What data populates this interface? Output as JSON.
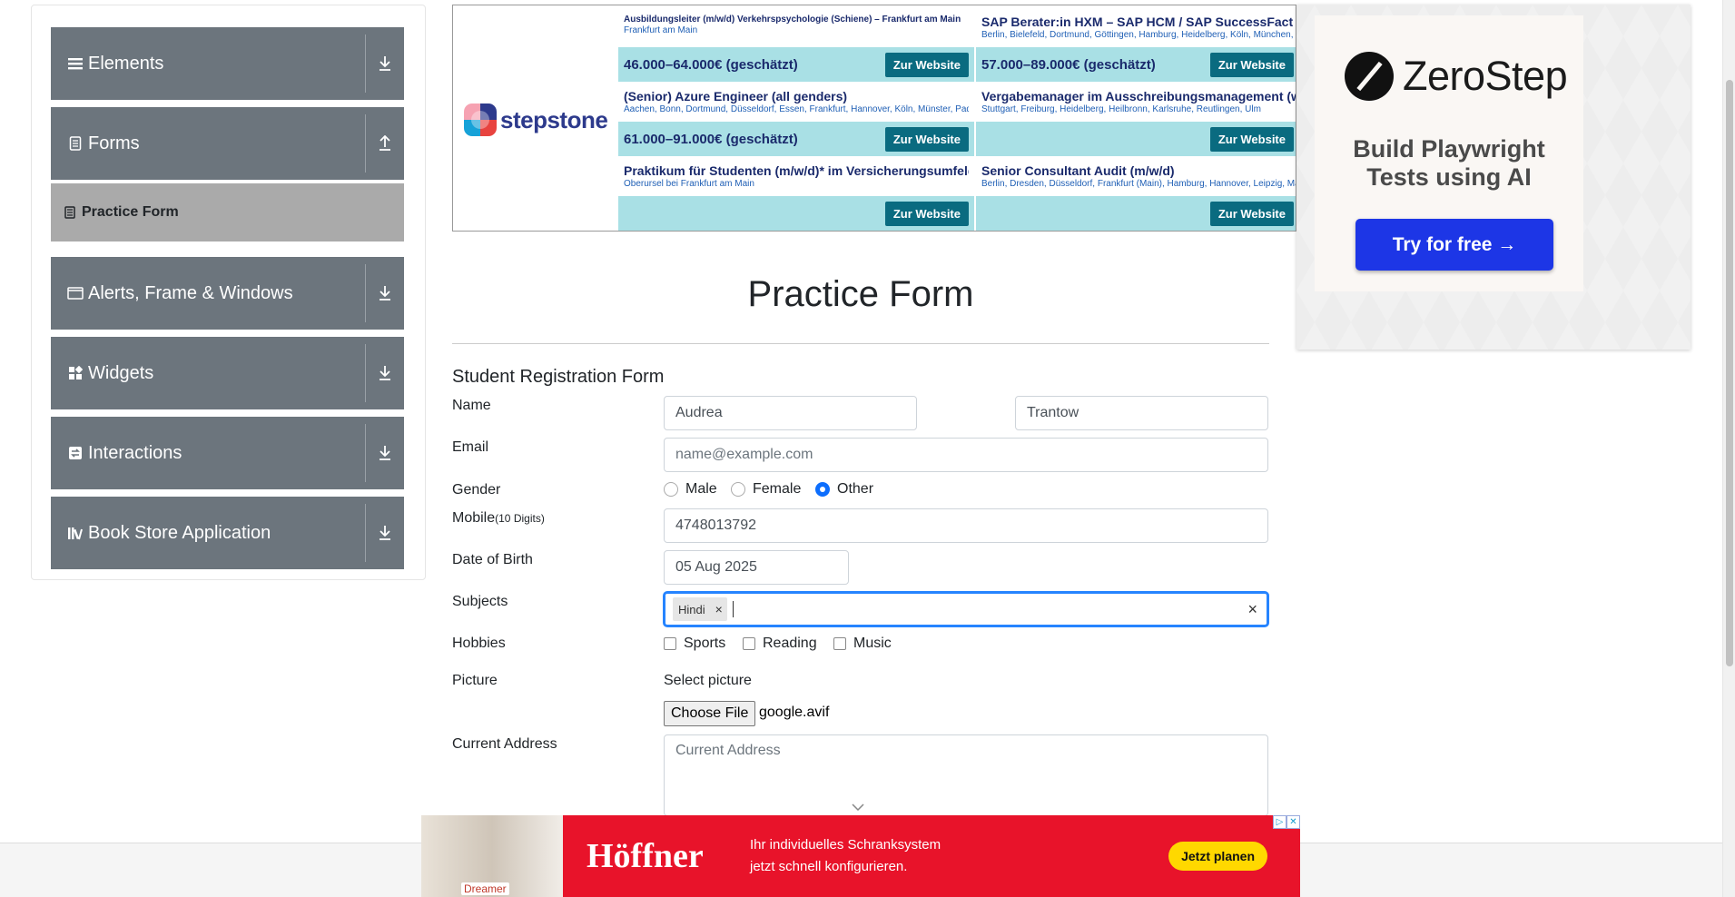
{
  "sidebar": {
    "groups": [
      {
        "label": "Elements",
        "icon": "hamburger-icon",
        "arrow": "download-icon"
      },
      {
        "label": "Forms",
        "icon": "document-icon",
        "arrow": "upload-icon"
      },
      {
        "label": "Alerts, Frame & Windows",
        "icon": "window-icon",
        "arrow": "download-icon"
      },
      {
        "label": "Widgets",
        "icon": "widgets-icon",
        "arrow": "download-icon"
      },
      {
        "label": "Interactions",
        "icon": "interactions-icon",
        "arrow": "download-icon"
      },
      {
        "label": "Book Store Application",
        "icon": "books-icon",
        "arrow": "download-icon"
      }
    ],
    "active_item": "Practice Form"
  },
  "stepstone_ad": {
    "brand": "stepstone",
    "jobs": [
      {
        "title": "Ausbildungsleiter (m/w/d) Verkehrspsychologie (Schiene) – Frankfurt am Main",
        "location": "Frankfurt am Main",
        "salary": "46.000–64.000€ (geschätzt)",
        "button": "Zur Website"
      },
      {
        "title": "SAP Berater:in HXM – SAP HCM / SAP SuccessFact",
        "location": "Berlin, Bielefeld, Dortmund, Göttingen, Hamburg, Heidelberg, Köln, München, Pforzheim",
        "salary": "57.000–89.000€ (geschätzt)",
        "button": "Zur Website"
      },
      {
        "title": "(Senior) Azure Engineer (all genders)",
        "location": "Aachen, Bonn, Dortmund, Düsseldorf, Essen, Frankfurt, Hannover, Köln, Münster, Paderborn...",
        "salary": "61.000–91.000€ (geschätzt)",
        "button": "Zur Website"
      },
      {
        "title": "Vergabemanager im Ausschreibungsmanagement (w/m",
        "location": "Stuttgart, Freiburg, Heidelberg, Heilbronn, Karlsruhe, Reutlingen, Ulm",
        "salary": "",
        "button": "Zur Website"
      },
      {
        "title": "Praktikum für Studenten (m/w/d)* im Versicherungsumfeld",
        "location": "Oberursel bei Frankfurt am Main",
        "salary": "",
        "button": "Zur Website"
      },
      {
        "title": "Senior Consultant Audit (m/w/d)",
        "location": "Berlin, Dresden, Düsseldorf, Frankfurt (Main), Hamburg, Hannover, Leipzig, Magdeburg",
        "salary": "",
        "button": "Zur Website"
      }
    ]
  },
  "zerostep_ad": {
    "brand": "ZeroStep",
    "tagline": "Build Playwright Tests using AI",
    "button": "Try for free →"
  },
  "form": {
    "page_title": "Practice Form",
    "form_title": "Student Registration Form",
    "labels": {
      "name": "Name",
      "email": "Email",
      "gender": "Gender",
      "mobile": "Mobile",
      "mobile_hint": "(10 Digits)",
      "dob": "Date of Birth",
      "subjects": "Subjects",
      "hobbies": "Hobbies",
      "picture": "Picture",
      "address": "Current Address"
    },
    "first_name": "Audrea",
    "last_name": "Trantow",
    "email_placeholder": "name@example.com",
    "genders": [
      {
        "label": "Male",
        "checked": false
      },
      {
        "label": "Female",
        "checked": false
      },
      {
        "label": "Other",
        "checked": true
      }
    ],
    "mobile": "4748013792",
    "dob": "05 Aug 2025",
    "subjects": [
      "Hindi"
    ],
    "subject_remove": "×",
    "subjects_clear": "×",
    "hobbies": [
      {
        "label": "Sports",
        "checked": false
      },
      {
        "label": "Reading",
        "checked": false
      },
      {
        "label": "Music",
        "checked": false
      }
    ],
    "picture_label": "Select picture",
    "file_button": "Choose File",
    "file_name": "google.avif",
    "address_placeholder": "Current Address"
  },
  "hoffner_ad": {
    "brand": "Höffner",
    "line1": "Ihr individuelles Schranksystem",
    "line2": "jetzt schnell konfigurieren.",
    "button": "Jetzt planen",
    "photo_tag": "Dreamer"
  },
  "colors": {
    "sidebar_group": "#6c757d",
    "active_item": "#aaaaaa",
    "focus": "#2684ff",
    "radio_checked": "#0d6efd",
    "ss_salary_bg": "#a9e0e5",
    "ss_button": "#0a6b80",
    "zerostep_button": "#1d36e6",
    "hoffner_red": "#e8132a",
    "hoffner_button": "#ffd800"
  }
}
